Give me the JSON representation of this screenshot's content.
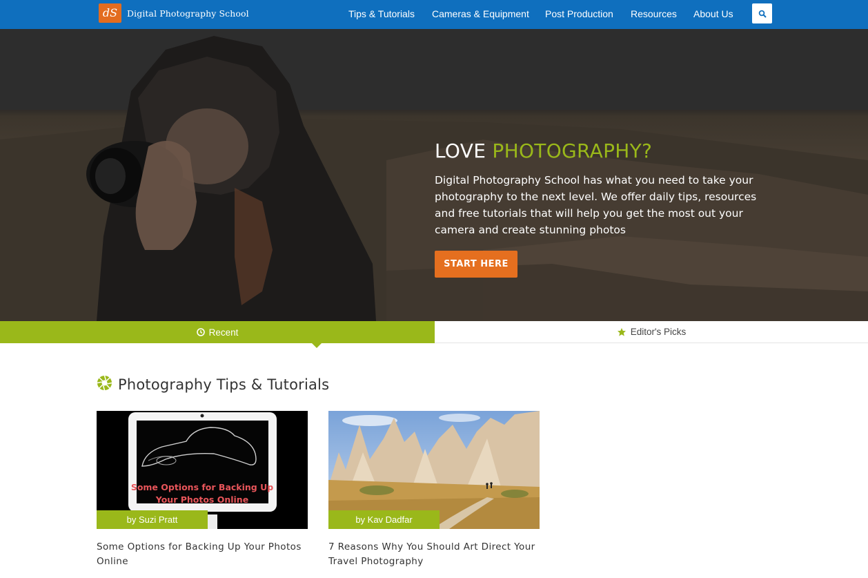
{
  "site": {
    "logo_mark": "dS",
    "name": "Digital Photography School"
  },
  "nav": {
    "items": [
      {
        "label": "Tips & Tutorials"
      },
      {
        "label": "Cameras & Equipment"
      },
      {
        "label": "Post Production"
      },
      {
        "label": "Resources"
      },
      {
        "label": "About Us"
      }
    ],
    "search_icon": "search-icon"
  },
  "hero": {
    "title_plain": "LOVE",
    "title_accent": "PHOTOGRAPHY?",
    "text": "Digital Photography School has what you need to take your photography to the next level. We offer daily tips, resources and free tutorials that will help you get the most out your camera and create stunning photos",
    "cta_label": "START HERE"
  },
  "tabs": [
    {
      "label": "Recent",
      "icon": "clock-icon",
      "active": true
    },
    {
      "label": "Editor's Picks",
      "icon": "star-icon",
      "active": false
    }
  ],
  "section": {
    "title": "Photography Tips & Tutorials",
    "icon": "aperture-icon"
  },
  "articles": [
    {
      "author": "by Suzi Pratt",
      "title": "Some Options for Backing Up Your Photos Online",
      "image_text_line1": "Some Options for Backing Up",
      "image_text_line2": "Your Photos Online"
    },
    {
      "author": "by Kav Dadfar",
      "title": "7 Reasons Why You Should Art Direct Your Travel Photography"
    }
  ],
  "colors": {
    "nav_bg": "#0f6fbe",
    "accent_green": "#9ab81a",
    "cta_orange": "#e56f1f",
    "logo_orange": "#e36c1f"
  }
}
